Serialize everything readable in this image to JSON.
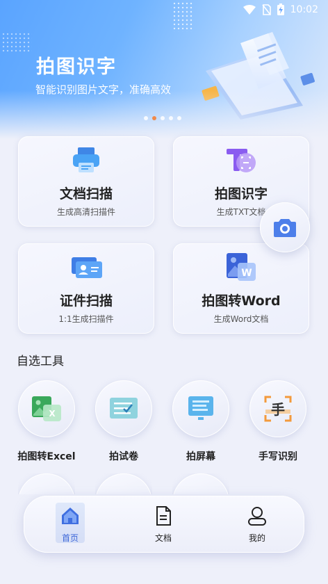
{
  "status_bar": {
    "time": "10:02",
    "icons": [
      "wifi-icon",
      "no-sim-icon",
      "battery-charging-icon"
    ]
  },
  "banner": {
    "title": "拍图识字",
    "subtitle": "智能识别图片文字，准确高效",
    "slides_count": 5,
    "active_slide": 1,
    "accent_color": "#f08a4b"
  },
  "cards": [
    {
      "title": "文档扫描",
      "subtitle": "生成高清扫描件",
      "icon": "printer-icon"
    },
    {
      "title": "拍图识字",
      "subtitle": "生成TXT文档",
      "icon": "text-recognition-icon"
    },
    {
      "title": "证件扫描",
      "subtitle": "1:1生成扫描件",
      "icon": "id-card-icon"
    },
    {
      "title": "拍图转Word",
      "subtitle": "生成Word文档",
      "icon": "word-icon"
    }
  ],
  "fab": {
    "icon": "camera-icon"
  },
  "tools_section": {
    "title": "自选工具",
    "items": [
      {
        "label": "拍图转Excel",
        "icon": "excel-icon"
      },
      {
        "label": "拍试卷",
        "icon": "exam-paper-icon"
      },
      {
        "label": "拍屏幕",
        "icon": "screen-icon"
      },
      {
        "label": "手写识别",
        "icon": "handwriting-icon"
      }
    ]
  },
  "bottom_nav": {
    "items": [
      {
        "label": "首页",
        "icon": "home-icon",
        "active": true
      },
      {
        "label": "文档",
        "icon": "document-icon",
        "active": false
      },
      {
        "label": "我的",
        "icon": "profile-icon",
        "active": false
      }
    ]
  }
}
